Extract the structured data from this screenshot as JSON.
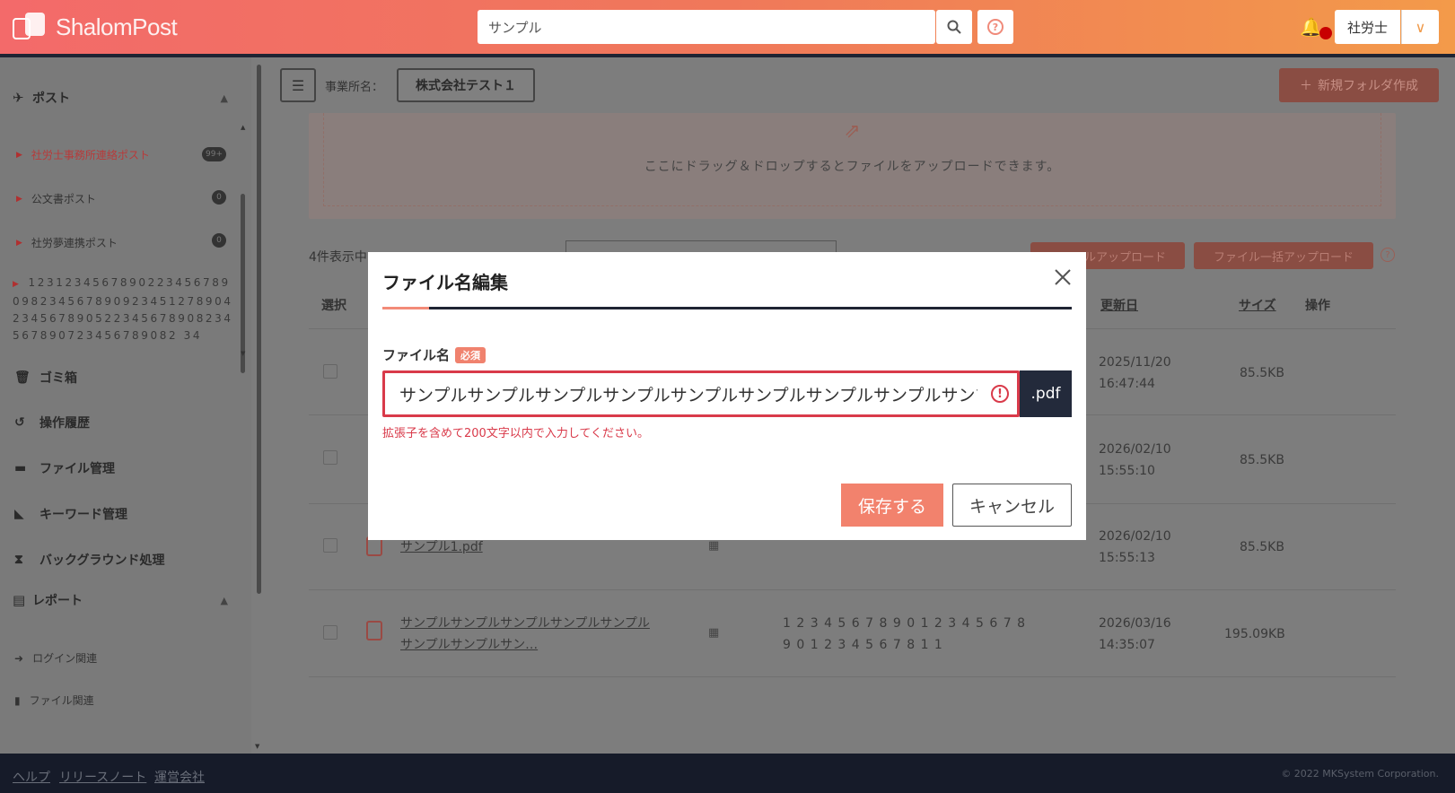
{
  "header": {
    "logo_text": "ShalomPost",
    "search_value": "サンプル",
    "user_name": "社労士"
  },
  "sidebar": {
    "post_section": "ポスト",
    "post_items": [
      {
        "label": "社労士事務所連絡ポスト",
        "badge": "99+"
      },
      {
        "label": "公文書ポスト",
        "badge": "0"
      },
      {
        "label": "社労夢連携ポスト",
        "badge": "0"
      }
    ],
    "long_item": "1231234567890223456789098234567890923451278904234567890522345678908234567890723456789082 34",
    "menu": [
      {
        "label": "ゴミ箱"
      },
      {
        "label": "操作履歴"
      },
      {
        "label": "ファイル管理"
      },
      {
        "label": "キーワード管理"
      },
      {
        "label": "バックグラウンド処理"
      }
    ],
    "report_section": "レポート",
    "report_items": [
      {
        "label": "ログイン関連"
      },
      {
        "label": "ファイル関連"
      }
    ]
  },
  "main": {
    "office_label": "事業所名：",
    "office_value": "株式会社テスト１",
    "new_folder": "新規フォルダ作成",
    "dropzone_text": "ここにドラッグ＆ドロップするとファイルをアップロードできます。",
    "count": "4件表示中",
    "upload_file": "ファイルアップロード",
    "upload_bulk": "ファイル一括アップロード",
    "columns": {
      "select": "選択",
      "updated": "更新日",
      "size": "サイズ",
      "ops": "操作"
    },
    "rows": [
      {
        "date": "2025/11/20",
        "time": "16:47:44",
        "size": "85.5KB",
        "name": "",
        "memo": ""
      },
      {
        "date": "2026/02/10",
        "time": "15:55:10",
        "size": "85.5KB",
        "name": "",
        "memo": ""
      },
      {
        "date": "2026/02/10",
        "time": "15:55:13",
        "size": "85.5KB",
        "name": "サンプル1.pdf",
        "memo": ""
      },
      {
        "date": "2026/03/16",
        "time": "14:35:07",
        "size": "195.09KB",
        "name": "サンプルサンプルサンプルサンプルサンプル",
        "name2": "サンプルサンプルサン…",
        "memo": "1 2 3 4 5 6 7 8 9 0 1 2 3 4 5 6 7 8",
        "memo2": "9 0 1 2 3 4 5 6 7 8 1 1"
      }
    ]
  },
  "footer": {
    "help": "ヘルプ",
    "release_notes": "リリースノート",
    "company": "運営会社",
    "copyright": "© 2022 MKSystem Corporation."
  },
  "modal": {
    "title": "ファイル名編集",
    "field_label": "ファイル名",
    "required": "必須",
    "filename_value": "サンプルサンプルサンプルサンプルサンプルサンプルサンプルサンプルサンプルサンプルサンプルサンプルサンプルサンプルサンプル",
    "extension": ".pdf",
    "error": "拡張子を含めて200文字以内で入力してください。",
    "save": "保存する",
    "cancel": "キャンセル"
  },
  "colors": {
    "accent": "#f2826d",
    "error": "#d93a4a",
    "navy": "#232a3b"
  }
}
